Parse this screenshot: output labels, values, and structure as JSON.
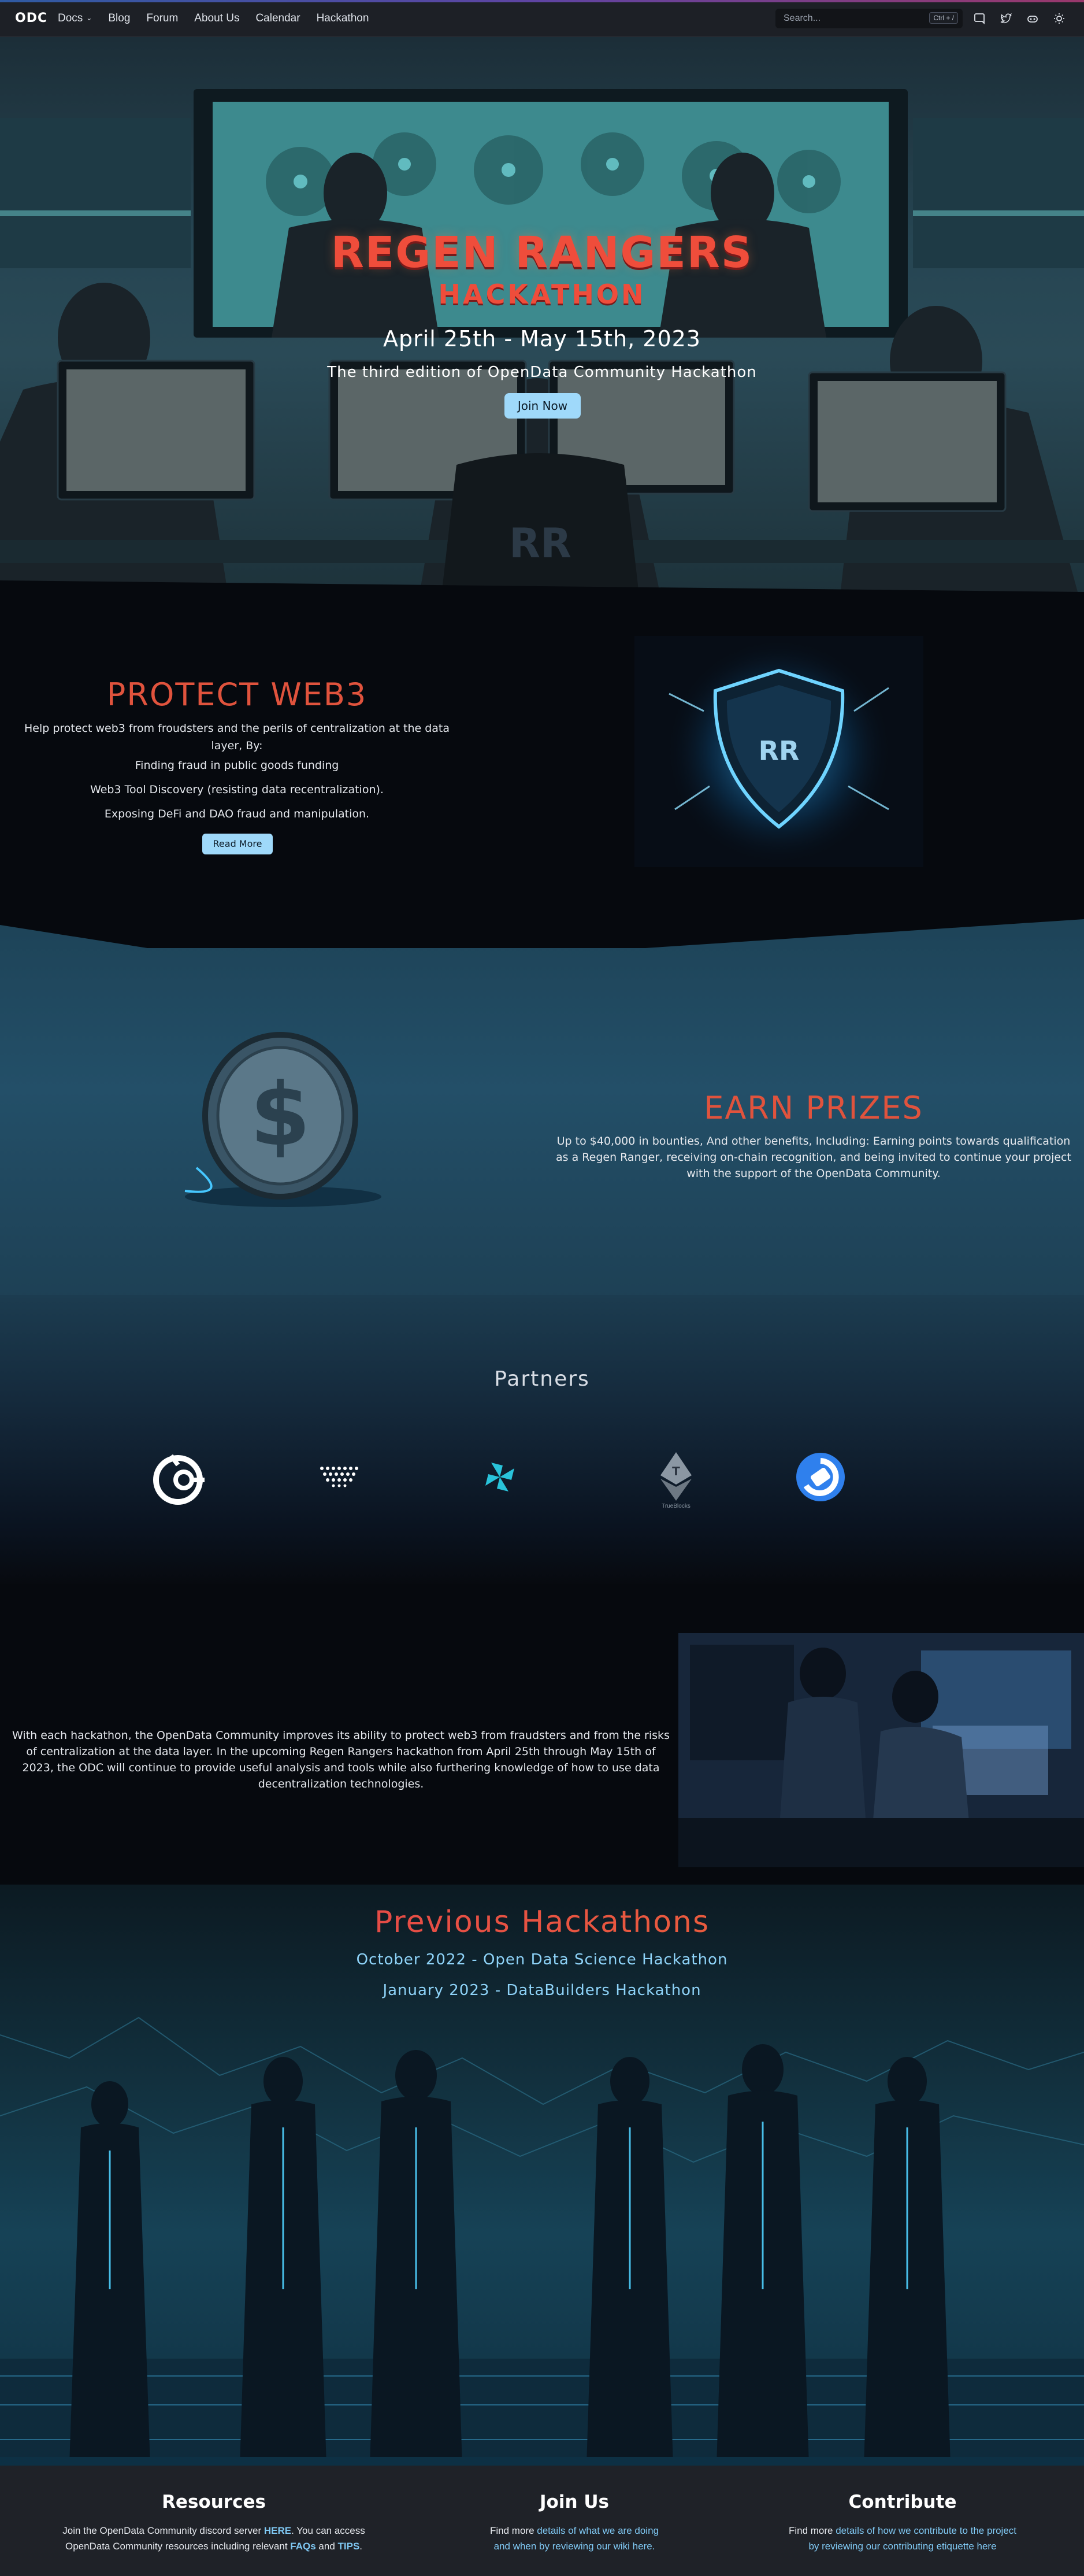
{
  "nav": {
    "brand": "ODC",
    "links": [
      "Docs",
      "Blog",
      "Forum",
      "About Us",
      "Calendar",
      "Hackathon"
    ],
    "search_placeholder": "Search...",
    "search_shortcut": "Ctrl + /",
    "icons": [
      "discord-icon",
      "twitter-icon",
      "github-icon",
      "theme-toggle-icon"
    ]
  },
  "hero": {
    "title": "REGEN RANGERS",
    "subtitle": "HACKATHON",
    "dates": "April 25th - May 15th, 2023",
    "tagline": "The third edition of OpenData Community Hackathon",
    "cta": "Join Now",
    "logo_text": "RR"
  },
  "protect": {
    "title": "PROTECT WEB3",
    "intro": "Help protect web3 from froudsters and the perils of centralization at the data layer, By:",
    "items": [
      "Finding fraud in public goods funding",
      "Web3 Tool Discovery (resisting data recentralization).",
      "Exposing DeFi and DAO fraud and manipulation."
    ],
    "button": "Read More"
  },
  "prizes": {
    "title": "EARN PRIZES",
    "body": "Up to $40,000 in bounties, And other benefits, Including: Earning points towards qualification as a Regen Ranger, receiving on-chain recognition, and being invited to continue your project with the support of the OpenData Community."
  },
  "partners": {
    "title": "Partners",
    "logos": [
      {
        "name": "gitcoin-logo"
      },
      {
        "name": "ocean-protocol-logo"
      },
      {
        "name": "pinwheel-logo"
      },
      {
        "name": "trueblocks-logo",
        "label": "TrueBlocks"
      },
      {
        "name": "blue-circle-logo"
      }
    ]
  },
  "about": {
    "body": "With each hackathon, the OpenData Community improves its ability to protect web3 from fraudsters and from the risks of centralization at the data layer. In the upcoming Regen Rangers hackathon from April 25th through May 15th of 2023, the ODC will continue to provide useful analysis and tools while also furthering knowledge of how to use data decentralization technologies."
  },
  "previous": {
    "title": "Previous Hackathons",
    "links": [
      "October 2022 - Open Data Science Hackathon",
      "January 2023 - DataBuilders Hackathon"
    ]
  },
  "footer": {
    "resources": {
      "title": "Resources",
      "t1": "Join the OpenData Community discord server ",
      "here": "HERE",
      "t2": ". You can access",
      "t3": "OpenData Community resources including relevant ",
      "faqs": "FAQs",
      "and": " and ",
      "tips": "TIPS",
      "end": "."
    },
    "join": {
      "title": "Join Us",
      "t1": "Find more ",
      "link1": "details of what we are doing",
      "link2": "and when by reviewing our wiki here."
    },
    "contribute": {
      "title": "Contribute",
      "t1": "Find more ",
      "link1": "details of how we contribute to the project",
      "link2": "by reviewing our contributing etiquette here"
    }
  },
  "colors": {
    "accent_red": "#e0533d",
    "button_blue": "#9fd9fa",
    "link_blue": "#80c9f4",
    "navbar": "#1d2026"
  }
}
